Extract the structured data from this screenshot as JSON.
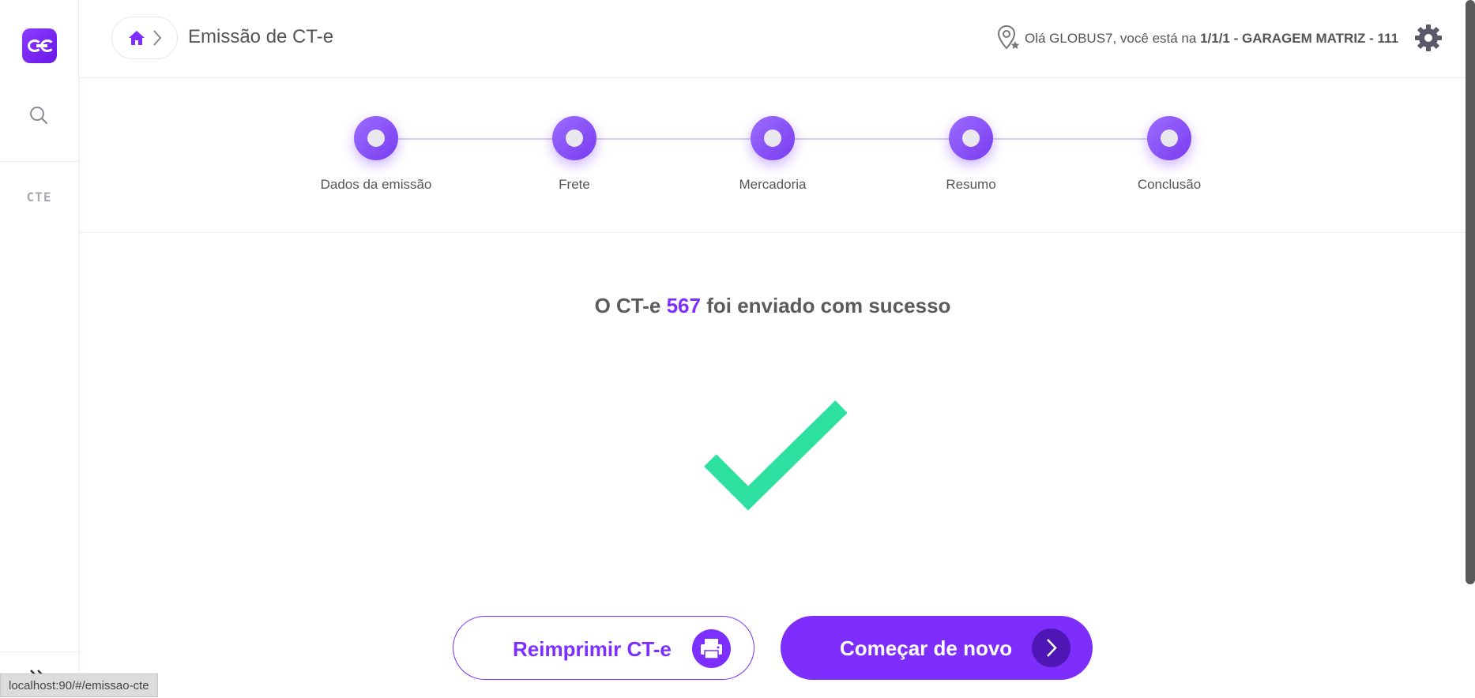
{
  "sidebar": {
    "module_label": "CTE"
  },
  "header": {
    "page_title": "Emissão de CT-e",
    "greeting_prefix": "Olá GLOBUS7, você está na ",
    "greeting_location": "1/1/1 - GARAGEM MATRIZ - 111"
  },
  "stepper": {
    "steps": [
      {
        "label": "Dados da emissão"
      },
      {
        "label": "Frete"
      },
      {
        "label": "Mercadoria"
      },
      {
        "label": "Resumo"
      },
      {
        "label": "Conclusão"
      }
    ]
  },
  "result": {
    "message_prefix": "O CT-e ",
    "cte_number": "567",
    "message_suffix": " foi enviado com sucesso"
  },
  "actions": {
    "reprint_label": "Reimprimir CT-e",
    "restart_label": "Começar de novo"
  },
  "status_bar": {
    "url": "localhost:90/#/emissao-cte"
  },
  "colors": {
    "accent": "#7c2fff",
    "success": "#2ee0a0",
    "text": "#555555"
  },
  "icons": [
    "logo",
    "search-icon",
    "expand-icon",
    "home-icon",
    "chevron-right-icon",
    "location-icon",
    "gear-icon",
    "check-icon",
    "printer-icon",
    "arrow-right-icon"
  ]
}
